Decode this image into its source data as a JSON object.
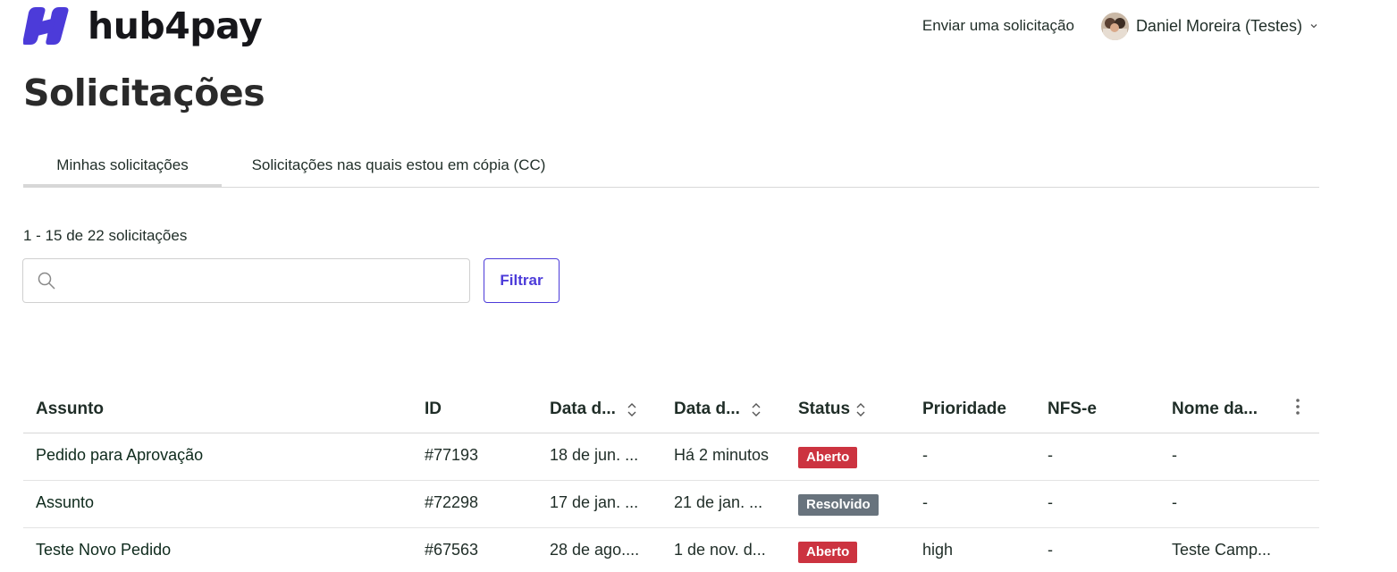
{
  "brand": {
    "name": "hub4pay",
    "color": "#4c3bd9"
  },
  "header": {
    "submit_link": "Enviar uma solicitação",
    "user_name": "Daniel Moreira (Testes)"
  },
  "page": {
    "title": "Solicitações",
    "tabs": [
      {
        "label": "Minhas solicitações",
        "active": true
      },
      {
        "label": "Solicitações nas quais estou em cópia (CC)",
        "active": false
      }
    ],
    "count_text": "1 - 15 de 22 solicitações",
    "search": {
      "placeholder": "",
      "value": ""
    },
    "filter_label": "Filtrar"
  },
  "table": {
    "columns": [
      "Assunto",
      "ID",
      "Data d...",
      "Data d...",
      "Status",
      "Prioridade",
      "NFS-e",
      "Nome da..."
    ],
    "rows": [
      {
        "assunto": "Pedido para Aprovação",
        "id": "#77193",
        "data1": "18 de jun. ...",
        "data2": "Há 2 minutos",
        "status": "Aberto",
        "prioridade": "-",
        "nfse": "-",
        "nome": "-"
      },
      {
        "assunto": "Assunto",
        "id": "#72298",
        "data1": "17 de jan. ...",
        "data2": "21 de jan. ...",
        "status": "Resolvido",
        "prioridade": "-",
        "nfse": "-",
        "nome": "-"
      },
      {
        "assunto": "Teste Novo Pedido",
        "id": "#67563",
        "data1": "28 de ago....",
        "data2": "1 de nov. d...",
        "status": "Aberto",
        "prioridade": "high",
        "nfse": "-",
        "nome": "Teste Camp..."
      }
    ]
  },
  "status_colors": {
    "Aberto": "#cc3340",
    "Resolvido": "#68737d"
  },
  "icons": {
    "search": "search-icon",
    "sort": "sort-icon",
    "more": "more-vertical-icon",
    "chevron": "chevron-down-icon"
  }
}
